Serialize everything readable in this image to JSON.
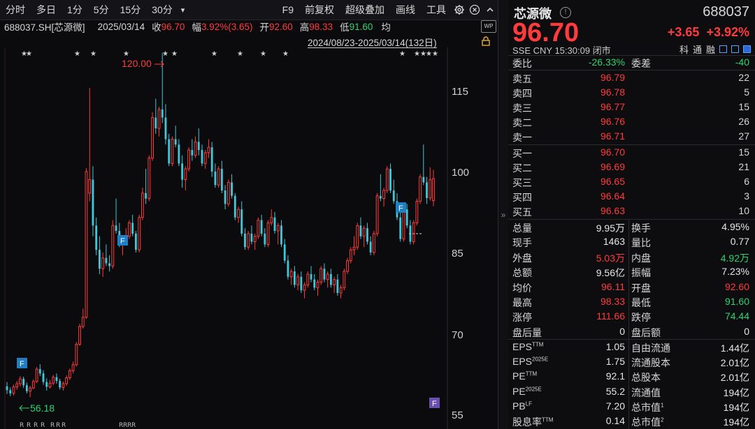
{
  "toolbar": {
    "left": [
      "分时",
      "多日",
      "1分",
      "5分",
      "15分",
      "30分"
    ],
    "more": "▾",
    "right": [
      "F9",
      "前复权",
      "超级叠加",
      "画线",
      "工具"
    ]
  },
  "infobar": {
    "code": "688037.SH[芯源微]",
    "date": "2025/03/14",
    "close_label": "收",
    "close": "96.70",
    "amp_label": "幅",
    "amp": "3.92%(3.65)",
    "open_label": "开",
    "open": "92.60",
    "high_label": "高",
    "high": "98.33",
    "low_label": "低",
    "low": "91.60",
    "avg_label": "均"
  },
  "range": "2024/08/23-2025/03/14(132日)",
  "chart_data": {
    "type": "candlestick",
    "y_ticks": [
      "115",
      "100",
      "85",
      "70",
      "55"
    ],
    "ylim": [
      50.3,
      121
    ],
    "max_label": "120.00",
    "min_label": "56.18",
    "markers": [
      "F",
      "F",
      "F",
      "F"
    ],
    "ohlc": [
      [
        58.2,
        59.0,
        56.8,
        57.5
      ],
      [
        57.5,
        58.0,
        56.4,
        56.9
      ],
      [
        56.9,
        58.5,
        56.5,
        58.1
      ],
      [
        58.1,
        59.2,
        57.6,
        58.7
      ],
      [
        58.7,
        60.1,
        58.2,
        59.6
      ],
      [
        59.6,
        60.0,
        57.9,
        58.4
      ],
      [
        58.4,
        58.9,
        56.9,
        57.3
      ],
      [
        57.3,
        58.3,
        56.2,
        57.9
      ],
      [
        57.9,
        59.5,
        57.7,
        59.1
      ],
      [
        59.1,
        61.8,
        58.8,
        61.4
      ],
      [
        61.4,
        62.3,
        60.1,
        60.6
      ],
      [
        60.6,
        61.2,
        58.5,
        59.0
      ],
      [
        59.0,
        59.7,
        57.4,
        58.1
      ],
      [
        58.1,
        59.4,
        57.8,
        58.8
      ],
      [
        58.8,
        60.3,
        58.4,
        59.9
      ],
      [
        59.9,
        60.6,
        58.7,
        59.2
      ],
      [
        59.2,
        59.6,
        57.6,
        58.0
      ],
      [
        58.0,
        59.1,
        57.4,
        58.7
      ],
      [
        58.7,
        60.2,
        58.3,
        59.8
      ],
      [
        59.8,
        61.5,
        59.4,
        61.1
      ],
      [
        61.1,
        62.8,
        60.6,
        62.2
      ],
      [
        62.2,
        66.4,
        61.9,
        66.0
      ],
      [
        66.0,
        69.8,
        65.7,
        69.3
      ],
      [
        69.3,
        72.6,
        68.9,
        71.0
      ],
      [
        71.0,
        98.6,
        70.7,
        98.0
      ],
      [
        94.0,
        113.5,
        92.5,
        96.5
      ],
      [
        96.5,
        99.0,
        86.0,
        88.0
      ],
      [
        88.0,
        89.5,
        82.5,
        83.5
      ],
      [
        83.5,
        86.0,
        79.0,
        80.0
      ],
      [
        80.0,
        83.0,
        78.5,
        82.0
      ],
      [
        82.0,
        84.5,
        80.5,
        81.0
      ],
      [
        81.0,
        82.5,
        79.5,
        80.5
      ],
      [
        80.5,
        89.0,
        80.0,
        88.0
      ],
      [
        88.0,
        93.0,
        86.5,
        87.0
      ],
      [
        87.0,
        88.5,
        84.0,
        84.5
      ],
      [
        84.5,
        86.0,
        82.5,
        85.5
      ],
      [
        85.5,
        87.5,
        84.5,
        86.0
      ],
      [
        86.0,
        89.0,
        85.5,
        88.5
      ],
      [
        88.5,
        90.0,
        86.0,
        86.5
      ],
      [
        86.5,
        87.0,
        83.0,
        83.5
      ],
      [
        83.5,
        90.0,
        83.0,
        89.5
      ],
      [
        89.5,
        95.0,
        89.0,
        94.0
      ],
      [
        94.0,
        98.5,
        92.0,
        93.0
      ],
      [
        93.0,
        101.0,
        92.5,
        100.5
      ],
      [
        100.5,
        109.0,
        100.0,
        108.0
      ],
      [
        108.0,
        111.5,
        105.0,
        106.0
      ],
      [
        106.0,
        110.0,
        104.5,
        109.5
      ],
      [
        109.5,
        120.0,
        107.0,
        108.0
      ],
      [
        108.0,
        110.5,
        103.0,
        104.0
      ],
      [
        104.0,
        105.0,
        99.0,
        99.5
      ],
      [
        99.5,
        104.5,
        99.0,
        104.0
      ],
      [
        104.0,
        106.5,
        102.5,
        103.0
      ],
      [
        103.0,
        104.0,
        99.0,
        99.5
      ],
      [
        99.5,
        101.0,
        95.0,
        96.5
      ],
      [
        96.5,
        99.0,
        94.5,
        98.5
      ],
      [
        98.5,
        102.5,
        98.0,
        102.0
      ],
      [
        102.0,
        104.0,
        100.0,
        101.0
      ],
      [
        101.0,
        104.5,
        100.5,
        103.5
      ],
      [
        103.5,
        106.0,
        101.0,
        102.0
      ],
      [
        102.0,
        103.0,
        99.0,
        99.5
      ],
      [
        99.5,
        102.0,
        98.5,
        101.5
      ],
      [
        101.5,
        104.0,
        100.5,
        102.5
      ],
      [
        102.5,
        103.5,
        97.0,
        98.0
      ],
      [
        98.0,
        99.5,
        95.0,
        95.5
      ],
      [
        95.5,
        99.0,
        95.0,
        98.5
      ],
      [
        98.5,
        100.0,
        94.0,
        94.5
      ],
      [
        94.5,
        95.5,
        91.0,
        92.0
      ],
      [
        92.0,
        96.5,
        91.5,
        96.0
      ],
      [
        96.0,
        97.5,
        93.0,
        93.5
      ],
      [
        93.5,
        94.0,
        89.0,
        89.5
      ],
      [
        89.5,
        91.5,
        88.5,
        91.0
      ],
      [
        91.0,
        92.5,
        86.0,
        86.5
      ],
      [
        86.5,
        87.5,
        83.5,
        84.0
      ],
      [
        84.0,
        87.0,
        83.5,
        86.5
      ],
      [
        86.5,
        88.0,
        84.5,
        85.0
      ],
      [
        85.0,
        86.5,
        83.5,
        86.0
      ],
      [
        86.0,
        89.5,
        85.5,
        89.0
      ],
      [
        89.0,
        90.0,
        86.0,
        86.5
      ],
      [
        86.5,
        87.5,
        84.0,
        84.5
      ],
      [
        84.5,
        89.0,
        84.0,
        88.5
      ],
      [
        88.5,
        91.0,
        88.0,
        89.5
      ],
      [
        89.5,
        90.5,
        86.5,
        87.0
      ],
      [
        87.0,
        88.5,
        84.5,
        88.0
      ],
      [
        88.0,
        89.0,
        84.0,
        84.5
      ],
      [
        84.5,
        85.5,
        81.0,
        81.5
      ],
      [
        81.5,
        82.5,
        78.0,
        78.5
      ],
      [
        78.5,
        80.0,
        77.0,
        79.5
      ],
      [
        79.5,
        80.5,
        76.5,
        77.0
      ],
      [
        77.0,
        79.0,
        76.0,
        78.5
      ],
      [
        78.5,
        79.5,
        75.5,
        76.0
      ],
      [
        76.0,
        77.5,
        74.5,
        77.0
      ],
      [
        77.0,
        79.5,
        76.5,
        79.0
      ],
      [
        79.0,
        80.5,
        77.5,
        78.0
      ],
      [
        78.0,
        79.0,
        76.0,
        76.5
      ],
      [
        76.5,
        78.0,
        75.0,
        77.5
      ],
      [
        77.5,
        80.5,
        77.0,
        80.0
      ],
      [
        80.0,
        81.0,
        77.5,
        78.0
      ],
      [
        78.0,
        79.5,
        76.5,
        79.0
      ],
      [
        79.0,
        80.0,
        76.5,
        77.0
      ],
      [
        77.0,
        78.5,
        75.5,
        78.0
      ],
      [
        78.0,
        79.0,
        75.0,
        75.5
      ],
      [
        75.5,
        77.0,
        74.5,
        76.5
      ],
      [
        76.5,
        80.0,
        76.0,
        79.5
      ],
      [
        79.5,
        82.0,
        79.0,
        81.5
      ],
      [
        81.5,
        84.0,
        81.0,
        83.5
      ],
      [
        83.5,
        86.0,
        82.5,
        84.0
      ],
      [
        84.0,
        88.5,
        83.5,
        88.0
      ],
      [
        88.0,
        89.5,
        85.5,
        86.0
      ],
      [
        86.0,
        88.0,
        84.0,
        87.5
      ],
      [
        87.5,
        88.5,
        84.5,
        85.0
      ],
      [
        85.0,
        86.0,
        82.5,
        83.0
      ],
      [
        83.0,
        87.0,
        82.5,
        86.5
      ],
      [
        86.5,
        94.0,
        86.0,
        93.5
      ],
      [
        93.5,
        97.5,
        92.5,
        93.0
      ],
      [
        93.0,
        95.0,
        91.5,
        94.5
      ],
      [
        94.5,
        99.0,
        94.0,
        98.5
      ],
      [
        98.5,
        99.5,
        94.0,
        94.5
      ],
      [
        94.5,
        96.5,
        92.0,
        92.5
      ],
      [
        92.5,
        94.0,
        89.0,
        89.5
      ],
      [
        89.5,
        90.5,
        85.0,
        85.5
      ],
      [
        85.5,
        91.5,
        85.0,
        91.0
      ],
      [
        91.0,
        92.0,
        87.5,
        88.0
      ],
      [
        88.0,
        89.0,
        84.5,
        85.0
      ],
      [
        85.0,
        89.0,
        84.5,
        88.5
      ],
      [
        88.5,
        93.0,
        88.0,
        92.5
      ],
      [
        92.5,
        97.5,
        92.0,
        97.0
      ],
      [
        97.0,
        103.0,
        95.5,
        96.0
      ],
      [
        96.0,
        97.0,
        92.0,
        93.1
      ],
      [
        93.1,
        98.8,
        92.6,
        96.5
      ],
      [
        92.6,
        98.33,
        91.6,
        96.7
      ]
    ]
  },
  "quote": {
    "name": "芯源微",
    "code": "688037",
    "price": "96.70",
    "change": "+3.65",
    "change_pct": "+3.92%",
    "meta": "SSE  CNY  15:30:09  闭市",
    "tags": [
      "科",
      "通",
      "融"
    ],
    "weibi_label": "委比",
    "weibi": "-26.33%",
    "weicha_label": "委差",
    "weicha": "-40"
  },
  "asks": [
    {
      "label": "卖五",
      "price": "96.79",
      "vol": "22"
    },
    {
      "label": "卖四",
      "price": "96.78",
      "vol": "5"
    },
    {
      "label": "卖三",
      "price": "96.77",
      "vol": "15"
    },
    {
      "label": "卖二",
      "price": "96.76",
      "vol": "26"
    },
    {
      "label": "卖一",
      "price": "96.71",
      "vol": "27"
    }
  ],
  "bids": [
    {
      "label": "买一",
      "price": "96.70",
      "vol": "15"
    },
    {
      "label": "买二",
      "price": "96.69",
      "vol": "21"
    },
    {
      "label": "买三",
      "price": "96.65",
      "vol": "6"
    },
    {
      "label": "买四",
      "price": "96.64",
      "vol": "3"
    },
    {
      "label": "买五",
      "price": "96.63",
      "vol": "10"
    }
  ],
  "stats": [
    {
      "l1": "总量",
      "v1": "9.95万",
      "c1": "white",
      "l2": "换手",
      "v2": "4.95%",
      "c2": "white"
    },
    {
      "l1": "现手",
      "v1": "1463",
      "c1": "white",
      "l2": "量比",
      "v2": "0.77",
      "c2": "white"
    },
    {
      "l1": "外盘",
      "v1": "5.03万",
      "c1": "red",
      "l2": "内盘",
      "v2": "4.92万",
      "c2": "green"
    },
    {
      "l1": "总额",
      "v1": "9.56亿",
      "c1": "white",
      "l2": "振幅",
      "v2": "7.23%",
      "c2": "white"
    },
    {
      "l1": "均价",
      "v1": "96.11",
      "c1": "red",
      "l2": "开盘",
      "v2": "92.60",
      "c2": "red"
    },
    {
      "l1": "最高",
      "v1": "98.33",
      "c1": "red",
      "l2": "最低",
      "v2": "91.60",
      "c2": "green"
    },
    {
      "l1": "涨停",
      "v1": "111.66",
      "c1": "red",
      "l2": "跌停",
      "v2": "74.44",
      "c2": "green"
    },
    {
      "l1": "盘后量",
      "v1": "0",
      "c1": "white",
      "l2": "盘后额",
      "v2": "0",
      "c2": "white"
    }
  ],
  "fundamentals": [
    {
      "l1": "EPS",
      "s1": "TTM",
      "v1": "1.05",
      "l2": "自由流通",
      "s2": "",
      "v2": "1.44亿"
    },
    {
      "l1": "EPS",
      "s1": "2025E",
      "v1": "1.75",
      "l2": "流通股本",
      "s2": "",
      "v2": "2.01亿"
    },
    {
      "l1": "PE",
      "s1": "TTM",
      "v1": "92.1",
      "l2": "总股本",
      "s2": "",
      "v2": "2.01亿"
    },
    {
      "l1": "PE",
      "s1": "2025E",
      "v1": "55.2",
      "l2": "流通值",
      "s2": "",
      "v2": "194亿"
    },
    {
      "l1": "PB",
      "s1": "LF",
      "v1": "7.20",
      "l2": "总市值",
      "s2": "1",
      "v2": "194亿"
    },
    {
      "l1": "股息率",
      "s1": "TTM",
      "v1": "0.14",
      "l2": "总市值",
      "s2": "2",
      "v2": "194亿"
    }
  ]
}
